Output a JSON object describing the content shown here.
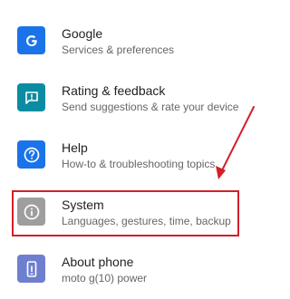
{
  "colors": {
    "google": "#1a73e8",
    "rating": "#0b8ca3",
    "help": "#1a73e8",
    "system": "#9e9e9e",
    "about": "#6f7fcf",
    "highlight": "#d21f2a"
  },
  "items": [
    {
      "title": "Google",
      "subtitle": "Services & preferences",
      "icon": "google-g-icon"
    },
    {
      "title": "Rating & feedback",
      "subtitle": "Send suggestions & rate your device",
      "icon": "feedback-icon"
    },
    {
      "title": "Help",
      "subtitle": "How-to & troubleshooting topics",
      "icon": "help-icon"
    },
    {
      "title": "System",
      "subtitle": "Languages, gestures, time, backup",
      "icon": "info-icon"
    },
    {
      "title": "About phone",
      "subtitle": "moto g(10) power",
      "icon": "phone-icon"
    }
  ]
}
